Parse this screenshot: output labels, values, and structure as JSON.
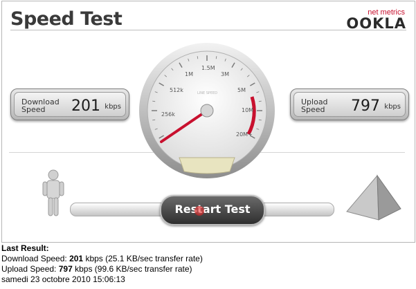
{
  "widget": {
    "title": "Speed Test",
    "brand": {
      "sub": "net metrics",
      "main": "OOKLA"
    },
    "download": {
      "label_line1": "Download",
      "label_line2": "Speed",
      "value": "201",
      "unit": "kbps"
    },
    "upload": {
      "label_line1": "Upload",
      "label_line2": "Speed",
      "value": "797",
      "unit": "kbps"
    },
    "gauge": {
      "labels": [
        "512k",
        "1M",
        "1.5M",
        "3M",
        "5M",
        "10M",
        "20M+",
        "256k"
      ],
      "center_text": "LINE SPEED"
    },
    "restart_label": "Restart Test"
  },
  "results": {
    "heading": "Last Result:",
    "download": {
      "prefix": "Download Speed: ",
      "value": "201",
      "suffix": " kbps (25.1 KB/sec transfer rate)"
    },
    "upload": {
      "prefix": "Upload Speed: ",
      "value": "797",
      "suffix": " kbps (99.6 KB/sec transfer rate)"
    },
    "date": "samedi 23 octobre 2010 15:06:13"
  },
  "colors": {
    "accent": "#c8102e",
    "frame": "#b5b5b5",
    "text": "#3a3a3a"
  }
}
